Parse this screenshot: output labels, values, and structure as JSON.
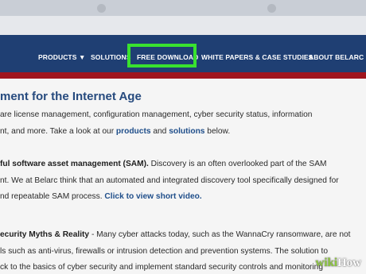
{
  "nav": {
    "products": "PRODUCTS ▼",
    "solutions": "SOLUTIONS",
    "free_download": "FREE DOWNLOAD",
    "white_papers": "WHITE PAPERS & CASE STUDIES",
    "about": "ABOUT BELARC ▼"
  },
  "content": {
    "heading": "ment for the Internet Age",
    "p1_line1": "are license management, configuration management, cyber security status, information",
    "p1_line2_pre": "nt, and more.  Take a look at our ",
    "p1_link_products": "products",
    "p1_and": " and ",
    "p1_link_solutions": "solutions",
    "p1_line2_post": " below.",
    "p2_bold": "ful software asset management (SAM).",
    "p2_line1_rest": " Discovery is an often overlooked part of the SAM",
    "p2_line2": "nt. We at Belarc think that an automated and integrated discovery tool specifically designed for",
    "p2_line3_pre": "nd repeatable SAM process. ",
    "p2_link_video": "Click to view short video.",
    "p3_bold": "ecurity Myths & Reality",
    "p3_line1_rest": " - Many cyber attacks today, such as the WannaCry ransomware, are not",
    "p3_line2": "ls such as anti-virus, firewalls or intrusion detection and prevention systems. The solution to",
    "p3_line3": "ck to the basics of cyber security and implement standard security controls and monitoring"
  },
  "watermark": {
    "wiki": "wiki",
    "how": "How"
  },
  "colors": {
    "navbar": "#1f3f73",
    "accent_red": "#a0151e",
    "highlight": "#39e22f",
    "link": "#1f4e8a",
    "heading": "#264a7e"
  }
}
